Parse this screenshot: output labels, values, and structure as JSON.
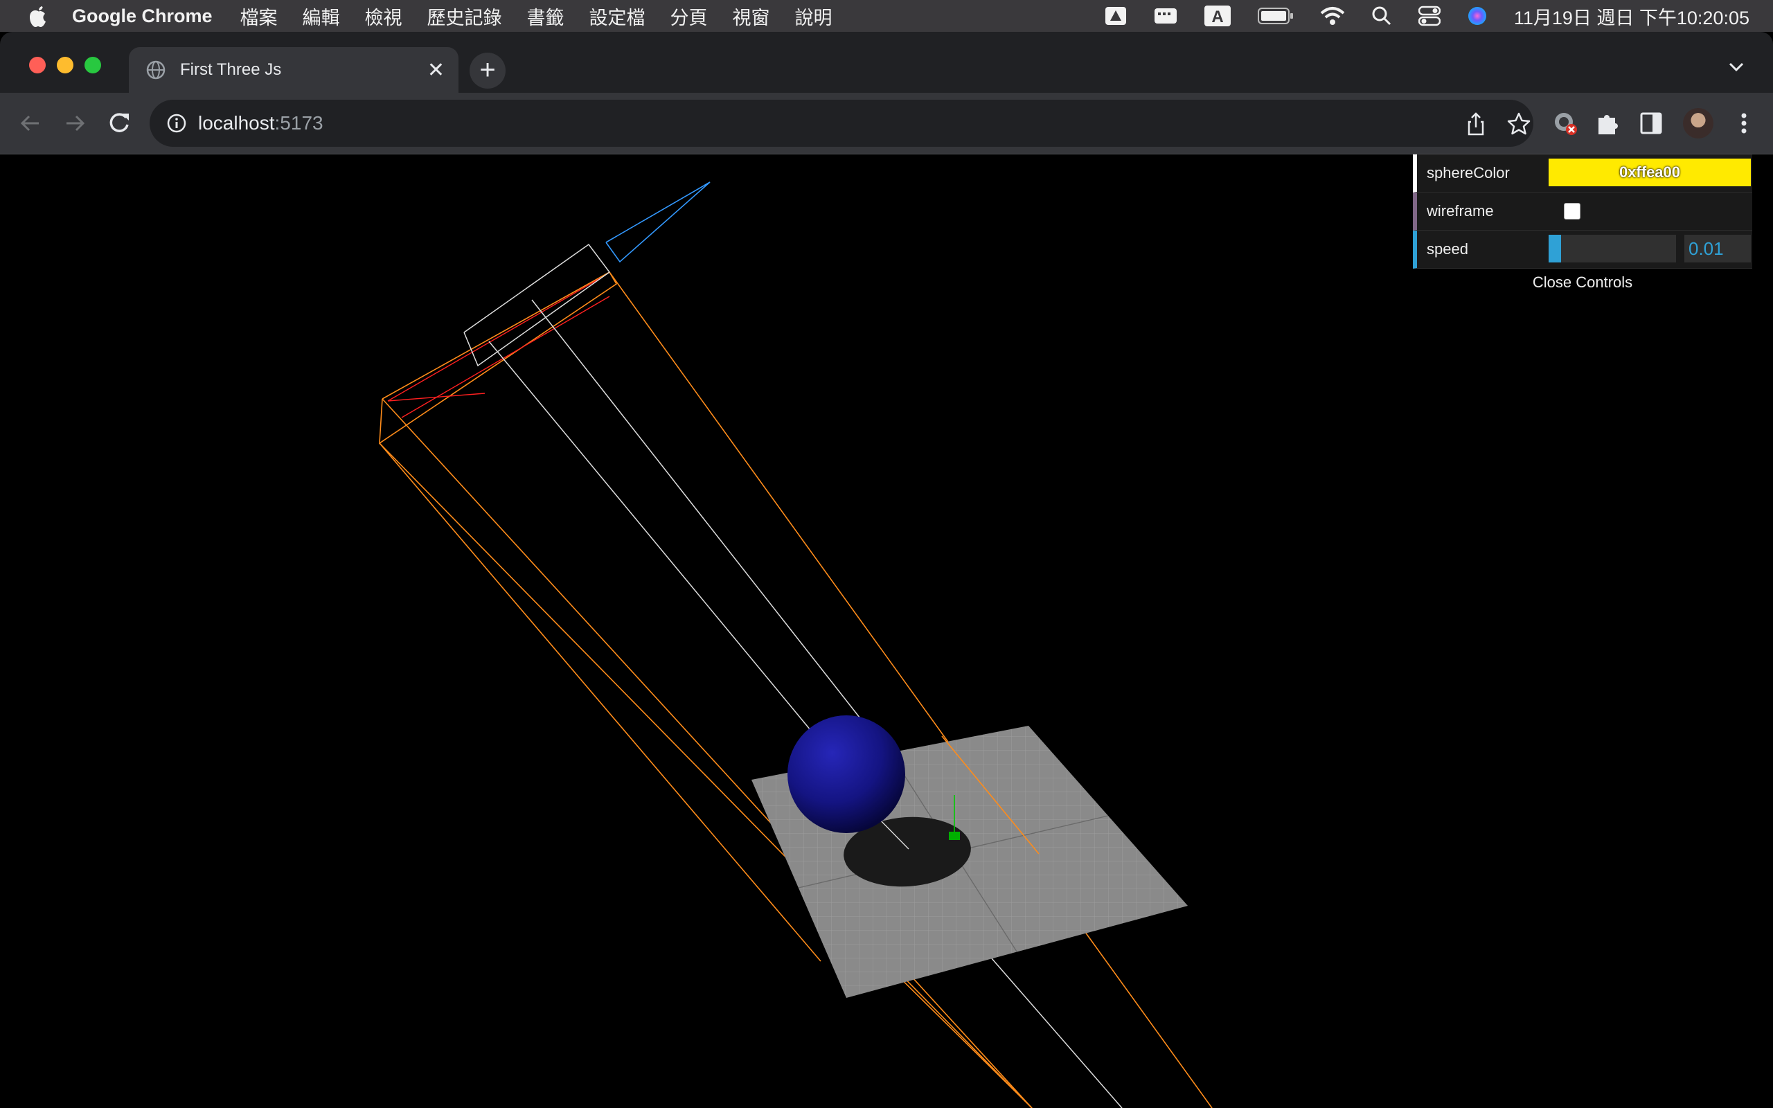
{
  "menubar": {
    "app_name": "Google Chrome",
    "items": [
      "檔案",
      "編輯",
      "檢視",
      "歷史記錄",
      "書籤",
      "設定檔",
      "分頁",
      "視窗",
      "說明"
    ],
    "input_method": "A",
    "clock": "11月19日 週日 下午10:20:05"
  },
  "browser": {
    "tab_title": "First Three Js",
    "url_host": "localhost",
    "url_port": ":5173"
  },
  "gui": {
    "sphereColor": {
      "label": "sphereColor",
      "value": "0xffea00",
      "swatch": "#ffea00"
    },
    "wireframe": {
      "label": "wireframe",
      "checked": false
    },
    "speed": {
      "label": "speed",
      "value": "0.01",
      "fraction": 0.1
    },
    "close_label": "Close Controls"
  },
  "scene": {
    "background": "#000000",
    "sphere_color": "#1a1a99",
    "plane_color": "#8a8a8a",
    "shadow_color": "#1a1a1a",
    "spotlight_helper_color": "#ff8c1a",
    "light_line_color": "#ffffff",
    "camera_helper_color": "#ff2020",
    "axes_colors": [
      "#00cc00",
      "#3399ff"
    ]
  }
}
